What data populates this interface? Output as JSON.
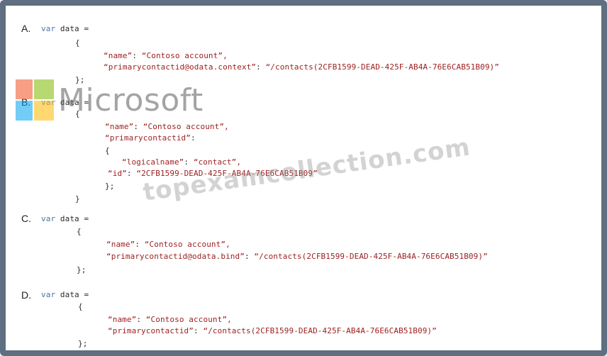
{
  "watermarks": {
    "brand": "Microsoft",
    "site": "topexamcollection.com"
  },
  "options": {
    "A": {
      "letter": "A.",
      "var_kw": "var",
      "decl": " data =",
      "open": "{",
      "name_key": "“name”",
      "name_sep": ": ",
      "name_val": "“Contoso account”,",
      "contact_key": "“primarycontactid@odata.context”",
      "contact_sep": ": ",
      "contact_val": "“/contacts(2CFB1599-DEAD-425F-AB4A-76E6CAB51B09)”",
      "close": "};"
    },
    "B": {
      "letter": "B.",
      "var_kw": "var",
      "decl": " data =",
      "open": "{",
      "name_key": "“name”",
      "name_sep": ": ",
      "name_val": "“Contoso account”,",
      "contact_key": "“primarycontactid”",
      "contact_sep": ":",
      "inner_open": "{",
      "logical_key": "“logicalname”",
      "logical_sep": ": ",
      "logical_val": "“contact”,",
      "id_key": "“id”",
      "id_sep": ": ",
      "id_val": "“2CFB1599-DEAD-425F-AB4A-76E6CAB51B09”",
      "inner_close": "};",
      "close": "}"
    },
    "C": {
      "letter": "C.",
      "var_kw": "var",
      "decl": " data =",
      "open": "{",
      "name_key": "“name”",
      "name_sep": ": ",
      "name_val": "“Contoso account”,",
      "contact_key": "“primarycontactid@odata.bind”",
      "contact_sep": ": ",
      "contact_val": "“/contacts(2CFB1599-DEAD-425F-AB4A-76E6CAB51B09)”",
      "close": "};"
    },
    "D": {
      "letter": "D.",
      "var_kw": "var",
      "decl": " data =",
      "open": "{",
      "name_key": "“name”",
      "name_sep": ": ",
      "name_val": "“Contoso account”,",
      "contact_key": "“primarycontactid”",
      "contact_sep": ": ",
      "contact_val": "“/contacts(2CFB1599-DEAD-425F-AB4A-76E6CAB51B09)”",
      "close": "};"
    }
  }
}
